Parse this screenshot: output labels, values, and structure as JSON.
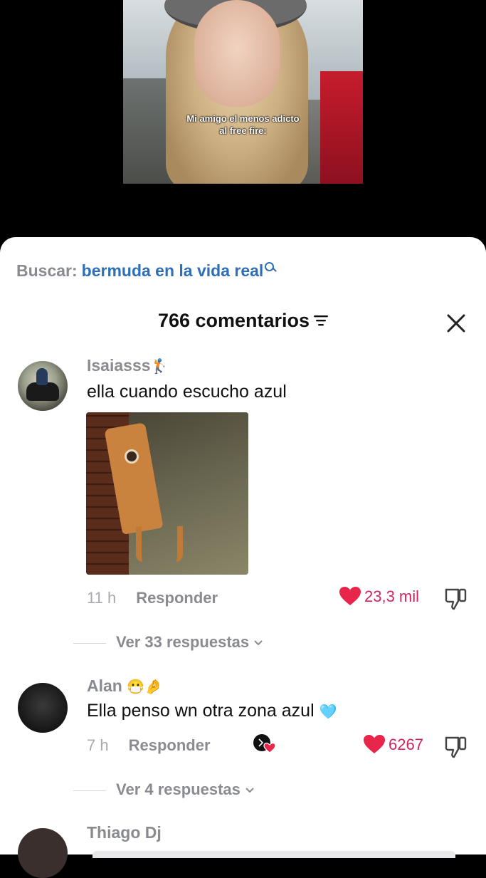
{
  "video": {
    "caption_line1": "Mi amigo el menos adicto",
    "caption_line2": "al free fire:"
  },
  "search": {
    "label": "Buscar:",
    "query": "bermuda en la vida real"
  },
  "comments_header": {
    "title": "766 comentarios"
  },
  "comments": [
    {
      "username": "Isaiasss",
      "username_emoji": "🏌",
      "text": "ella cuando escucho azul",
      "time": "11 h",
      "reply_label": "Responder",
      "likes": "23,3 mil",
      "view_replies": "Ver 33 respuestas"
    },
    {
      "username": "Alan",
      "username_emoji": "😷🤌",
      "text": "Ella penso wn otra zona azul",
      "text_emoji": "🩵",
      "time": "7 h",
      "reply_label": "Responder",
      "likes": "6267",
      "view_replies": "Ver 4 respuestas"
    },
    {
      "username": "Thiago Dj"
    }
  ],
  "colors": {
    "accent_blue": "#2f6fb5",
    "like_red": "#e8254b",
    "muted_gray": "#8a8b91"
  }
}
